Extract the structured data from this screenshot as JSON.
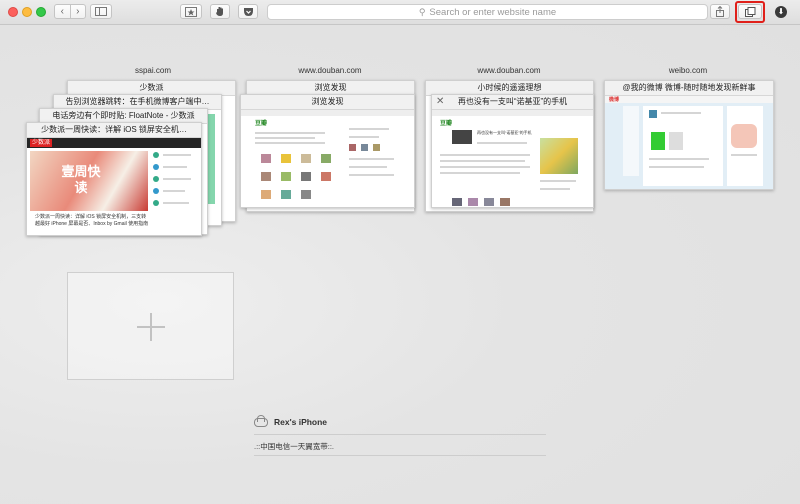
{
  "toolbar": {
    "address_placeholder": "Search or enter website name",
    "back_glyph": "‹",
    "forward_glyph": "›",
    "highlight_color": "#e0201a",
    "icons": [
      "sidebar-icon",
      "bookmarks-icon",
      "share-hand-icon",
      "pocket-icon",
      "share-icon",
      "tabs-overview-icon",
      "downloads-icon"
    ]
  },
  "tabs": [
    {
      "site": "sspai.com",
      "titles": [
        "少数派",
        "告别浏览器跳转：在手机微博客户端中…",
        "电话旁边有个即时贴: FloatNote - 少数派",
        "少数派一周快读：详解 iOS 锁屏安全机…"
      ],
      "thumb": {
        "logo": "少数派",
        "hero": "壹周快读",
        "caption": "少数派一周快读：详解 iOS 锁屏安全机制，三支转越最好 iPhone 屏幕是否、Inbox by Gmail 使用指南"
      }
    },
    {
      "site": "www.douban.com",
      "titles": [
        "浏览发现",
        "浏览发现"
      ],
      "thumb": {
        "logo": "豆瓣"
      }
    },
    {
      "site": "www.douban.com",
      "titles": [
        "小时候的遥遥理想",
        "再也没有一支叫“诺基亚”的手机"
      ],
      "thumb": {
        "logo": "豆瓣",
        "article": "再也没有一支叫“诺基亚”的手机"
      }
    },
    {
      "site": "weibo.com",
      "titles": [
        "@我的微博 微博-随时随地发现新鲜事"
      ],
      "thumb": {
        "logo": "微博"
      }
    }
  ],
  "new_tab": {
    "symbol": "+"
  },
  "icloud": {
    "device": "Rex's iPhone",
    "items": [
      ".::中国电信一天翼宽带::."
    ]
  }
}
